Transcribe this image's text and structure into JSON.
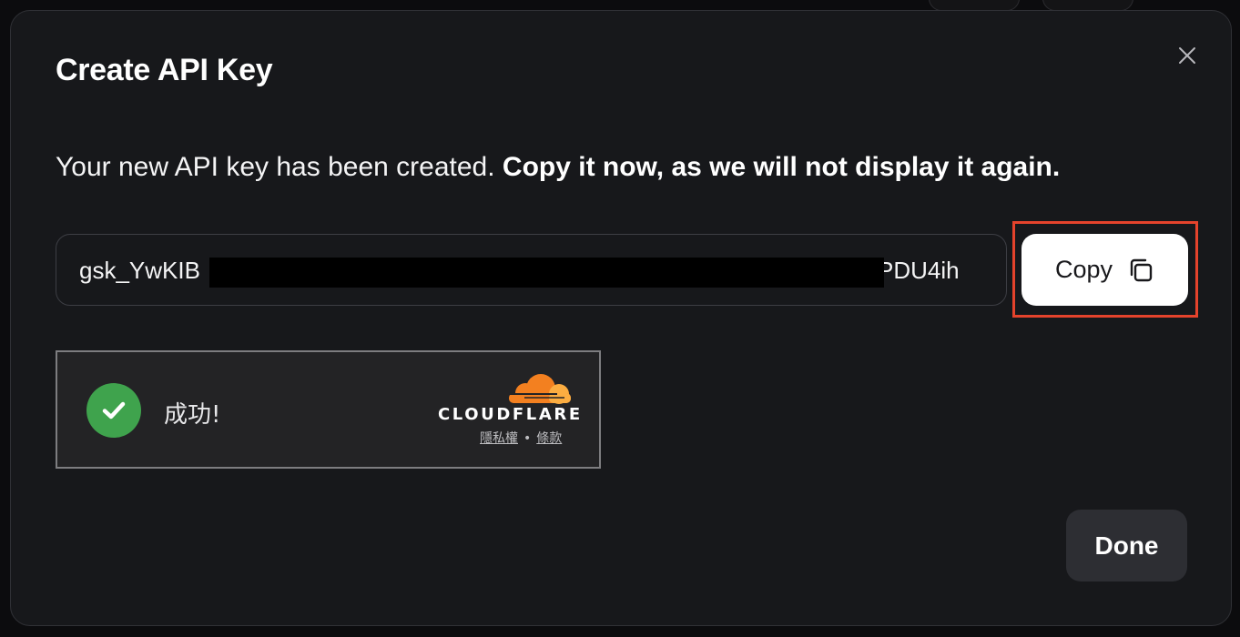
{
  "dialog": {
    "title": "Create API Key",
    "description": "Your new API key has been created.",
    "description_emphasis": "Copy it now, as we will not display it again."
  },
  "api_key": {
    "visible_prefix": "gsk_YwKIB",
    "visible_suffix": "PDU4ih"
  },
  "copy_button": {
    "label": "Copy",
    "icon": "copy-icon"
  },
  "turnstile": {
    "status": "成功!",
    "brand": "CLOUDFLARE",
    "privacy_link": "隱私權",
    "separator": "•",
    "terms_link": "條款",
    "status_color": "#3fa34d",
    "brand_color": "#f38020"
  },
  "done_button": {
    "label": "Done"
  },
  "colors": {
    "highlight": "#e5432c",
    "modal_bg": "#17181b"
  }
}
